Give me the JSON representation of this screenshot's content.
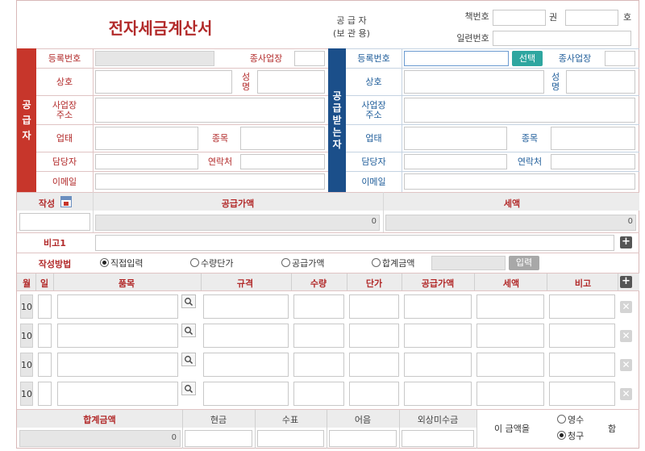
{
  "header": {
    "title": "전자세금계산서",
    "supplier_label": "공 급 자",
    "copy_label": "(보 관 용)",
    "book_no_label": "책번호 :",
    "volume_label": "권",
    "number_label": "호",
    "serial_no_label": "일련번호 :"
  },
  "supplier": {
    "side_label": [
      "공",
      "급",
      "자"
    ],
    "reg_no_label": "등록번호",
    "branch_label": "종사업장",
    "company_label": "상호",
    "name_label": [
      "성",
      "명"
    ],
    "address_label": [
      "사업장",
      "주소"
    ],
    "business_type_label": "업태",
    "business_item_label": "종목",
    "contact_person_label": "담당자",
    "phone_label": "연락처",
    "email_label": "이메일"
  },
  "buyer": {
    "side_label": [
      "공",
      "급",
      "받",
      "는",
      "자"
    ],
    "reg_no_label": "등록번호",
    "select_button": "선택",
    "branch_label": "종사업장",
    "company_label": "상호",
    "name_label": [
      "성",
      "명"
    ],
    "address_label": [
      "사업장",
      "주소"
    ],
    "business_type_label": "업태",
    "business_item_label": "종목",
    "contact_person_label": "담당자",
    "phone_label": "연락처",
    "email_label": "이메일"
  },
  "summary": {
    "date_label": "작성",
    "supply_amount_label": "공급가액",
    "tax_label": "세액",
    "supply_amount_value": "0",
    "tax_value": "0"
  },
  "memo": {
    "label": "비고1"
  },
  "method": {
    "label": "작성방법",
    "options": [
      "직접입력",
      "수량단가",
      "공급가액",
      "합계금액"
    ],
    "selected_index": 0,
    "input_button": "입력"
  },
  "items": {
    "headers": [
      "월",
      "일",
      "품목",
      "규격",
      "수량",
      "단가",
      "공급가액",
      "세액",
      "비고"
    ],
    "rows": [
      {
        "month": "10"
      },
      {
        "month": "10"
      },
      {
        "month": "10"
      },
      {
        "month": "10"
      }
    ]
  },
  "totals": {
    "total_label": "합계금액",
    "cash_label": "현금",
    "check_label": "수표",
    "note_label": "어음",
    "credit_label": "외상미수금",
    "total_value": "0",
    "amount_text": "이 금액을",
    "receipt_option": "영수",
    "claim_option": "청구",
    "selected": "claim",
    "suffix": "함"
  },
  "colors": {
    "supplier_accent": "#c7362b",
    "buyer_accent": "#1b4f8a",
    "select_button": "#2ea6a0"
  }
}
